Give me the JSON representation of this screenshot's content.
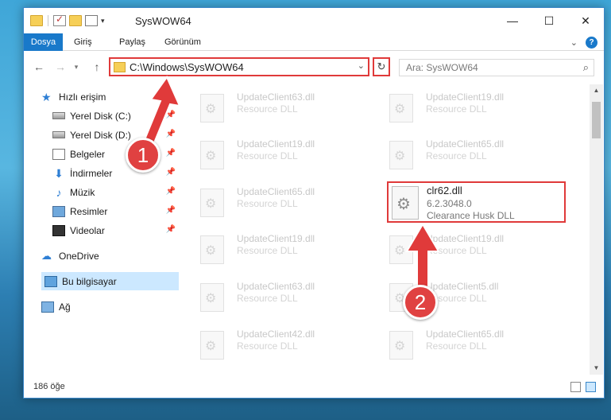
{
  "window": {
    "title": "SysWOW64",
    "controls": {
      "minimize": "—",
      "maximize": "☐",
      "close": "✕"
    }
  },
  "ribbon": {
    "tabs": [
      "Dosya",
      "Giriş",
      "Paylaş",
      "Görünüm"
    ],
    "expand_icon": "chevron-down-icon",
    "help": "?"
  },
  "navigation": {
    "back": "←",
    "forward": "→",
    "up": "↑",
    "address": "C:\\Windows\\SysWOW64",
    "refresh": "↻",
    "search_placeholder": "Ara: SysWOW64"
  },
  "sidebar": {
    "quick_access": "Hızlı erişim",
    "items": [
      {
        "label": "Yerel Disk (C:)",
        "icon": "drive-icon",
        "pinned": true
      },
      {
        "label": "Yerel Disk (D:)",
        "icon": "drive-icon",
        "pinned": true
      },
      {
        "label": "Belgeler",
        "icon": "documents-icon",
        "pinned": true
      },
      {
        "label": "İndirmeler",
        "icon": "downloads-icon",
        "pinned": true
      },
      {
        "label": "Müzik",
        "icon": "music-icon",
        "pinned": true
      },
      {
        "label": "Resimler",
        "icon": "pictures-icon",
        "pinned": true
      },
      {
        "label": "Videolar",
        "icon": "videos-icon",
        "pinned": true
      }
    ],
    "onedrive": "OneDrive",
    "this_pc": "Bu bilgisayar",
    "network": "Ağ"
  },
  "files": {
    "left": [
      {
        "name": "UpdateClient63.dll",
        "desc": "Resource DLL"
      },
      {
        "name": "UpdateClient19.dll",
        "desc": "Resource DLL"
      },
      {
        "name": "UpdateClient65.dll",
        "desc": "Resource DLL"
      },
      {
        "name": "UpdateClient19.dll",
        "desc": "Resource DLL"
      },
      {
        "name": "UpdateClient63.dll",
        "desc": "Resource DLL"
      },
      {
        "name": "UpdateClient42.dll",
        "desc": "Resource DLL"
      }
    ],
    "right": [
      {
        "name": "UpdateClient19.dll",
        "desc": "Resource DLL"
      },
      {
        "name": "UpdateClient65.dll",
        "desc": "Resource DLL"
      },
      {
        "name": "UpdateClient19.dll",
        "desc": "Resource DLL"
      },
      {
        "name": "UpdateClient5.dll",
        "desc": "Resource DLL"
      },
      {
        "name": "UpdateClient65.dll",
        "desc": "Resource DLL"
      }
    ],
    "highlighted": {
      "name": "clr62.dll",
      "version": "6.2.3048.0",
      "desc": "Clearance Husk DLL"
    }
  },
  "status": {
    "count": "186 öğe"
  },
  "annotations": {
    "step1": "1",
    "step2": "2",
    "color": "#e03a3a"
  }
}
